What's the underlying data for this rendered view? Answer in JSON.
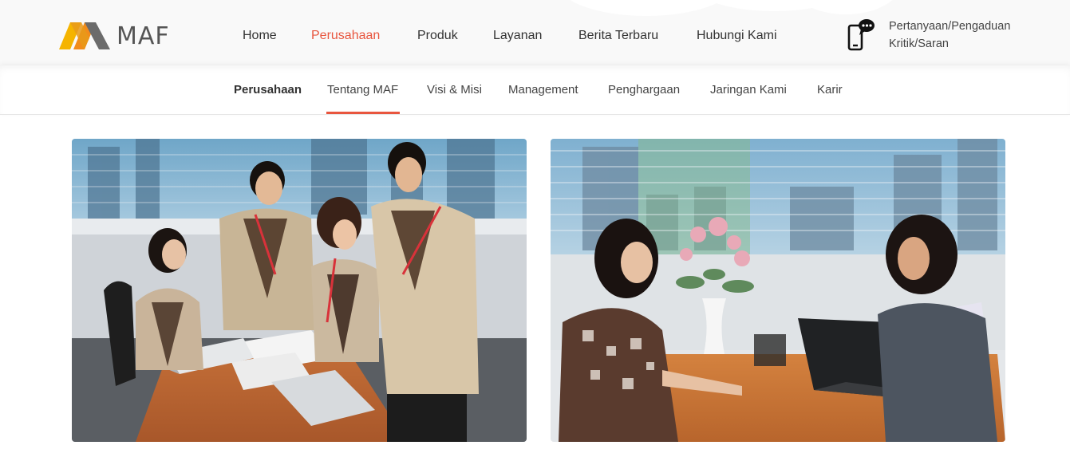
{
  "brand": {
    "name": "MAF",
    "logo_colors": [
      "#f5b400",
      "#f28c1a",
      "#e8553e"
    ]
  },
  "header": {
    "nav": [
      {
        "label": "Home",
        "active": false
      },
      {
        "label": "Perusahaan",
        "active": true
      },
      {
        "label": "Produk",
        "active": false
      },
      {
        "label": "Layanan",
        "active": false
      },
      {
        "label": "Berita Terbaru",
        "active": false
      },
      {
        "label": "Hubungi Kami",
        "active": false
      }
    ],
    "contact": {
      "icon": "phone-chat-icon",
      "line1": "Pertanyaan/Pengaduan",
      "line2": "Kritik/Saran"
    }
  },
  "subnav": {
    "heading": "Perusahaan",
    "items": [
      {
        "label": "Tentang MAF",
        "active": true
      },
      {
        "label": "Visi & Misi",
        "active": false
      },
      {
        "label": "Management",
        "active": false
      },
      {
        "label": "Penghargaan",
        "active": false
      },
      {
        "label": "Jaringan Kami",
        "active": false
      },
      {
        "label": "Karir",
        "active": false
      }
    ]
  },
  "photos": [
    {
      "name": "team-meeting-photo"
    },
    {
      "name": "customer-consultation-photo"
    }
  ],
  "colors": {
    "accent": "#e8553e",
    "header_bg": "#f9f9f9"
  }
}
